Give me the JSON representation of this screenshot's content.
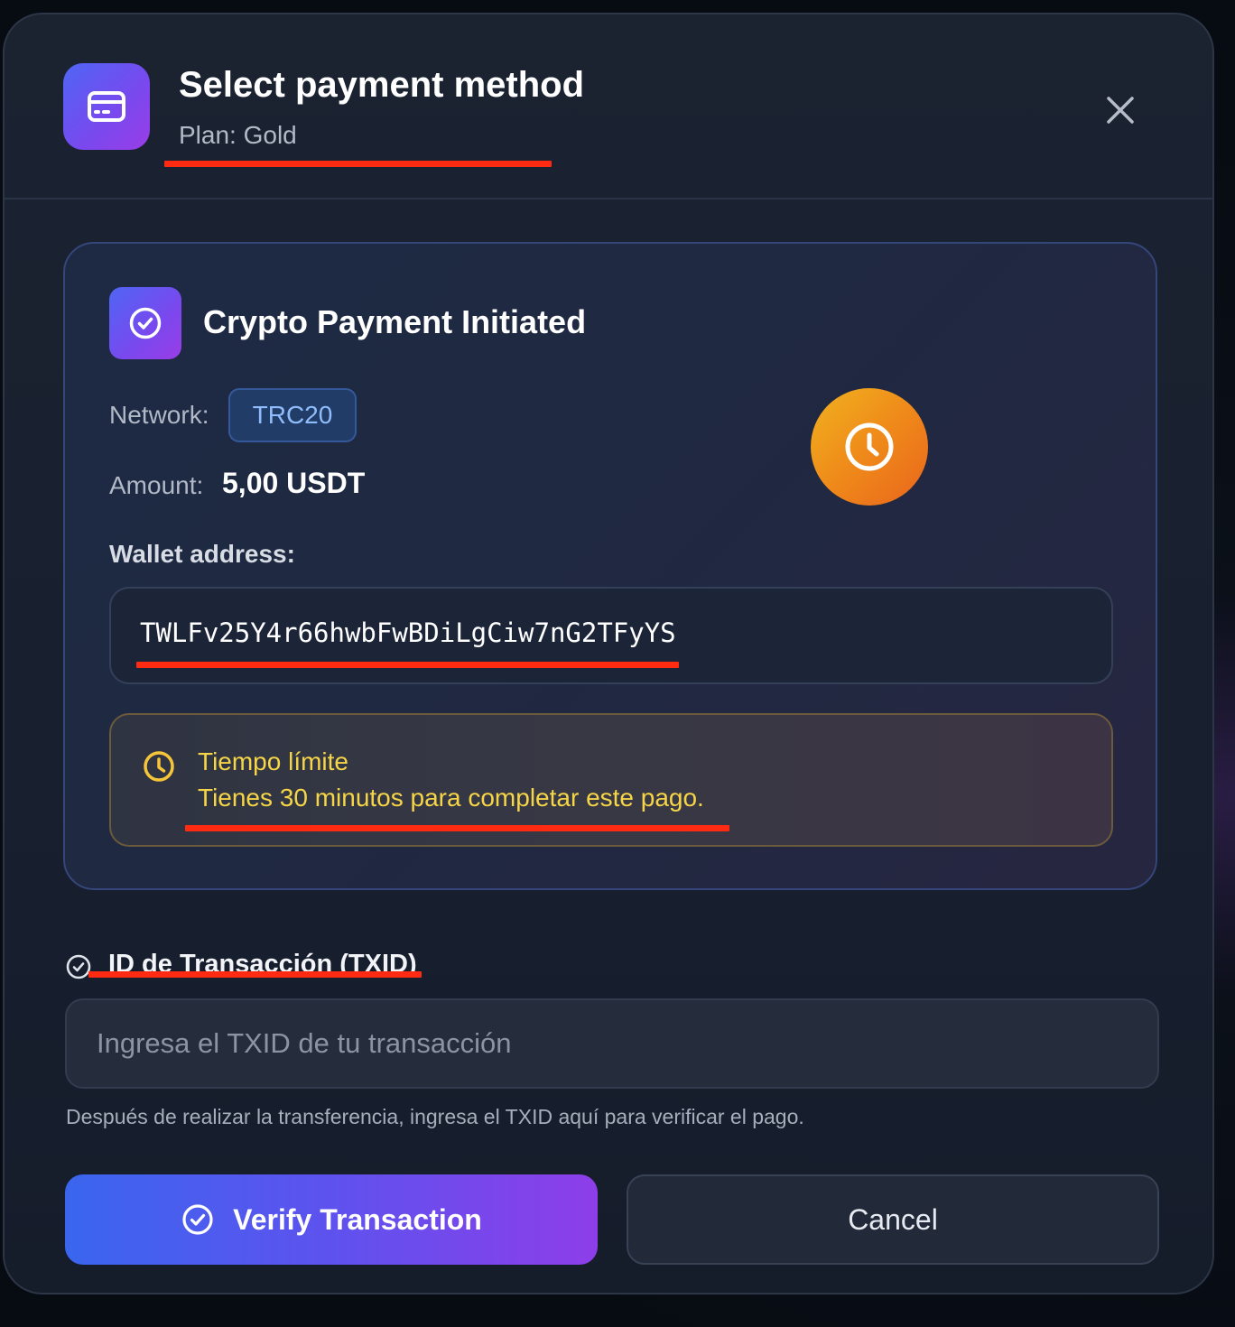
{
  "header": {
    "title": "Select payment method",
    "subtitle": "Plan: Gold",
    "icon": "credit-card-icon",
    "close_icon": "close-icon"
  },
  "card": {
    "icon": "check-circle-icon",
    "title": "Crypto Payment Initiated",
    "network_label": "Network:",
    "network_value": "TRC20",
    "amount_label": "Amount:",
    "amount_value": "5,00 USDT",
    "wallet_label": "Wallet address:",
    "wallet_address": "TWLFv25Y4r66hwbFwBDiLgCiw7nG2TFyYS",
    "status_icon": "clock-icon",
    "warning": {
      "icon": "clock-icon",
      "title": "Tiempo límite",
      "text": "Tienes 30 minutos para completar este pago."
    }
  },
  "txid": {
    "icon": "check-circle-icon",
    "label": "ID de Transacción (TXID)",
    "value": "",
    "placeholder": "Ingresa el TXID de tu transacción",
    "helper": "Después de realizar la transferencia, ingresa el TXID aquí para verificar el pago."
  },
  "actions": {
    "verify_icon": "check-circle-icon",
    "verify_label": "Verify Transaction",
    "cancel_label": "Cancel"
  },
  "colors": {
    "accent_start": "#3a66ee",
    "accent_end": "#8d3ee9",
    "warning": "#f6d547",
    "badge_text": "#8fbdfb",
    "annotation": "#ff2a12"
  }
}
